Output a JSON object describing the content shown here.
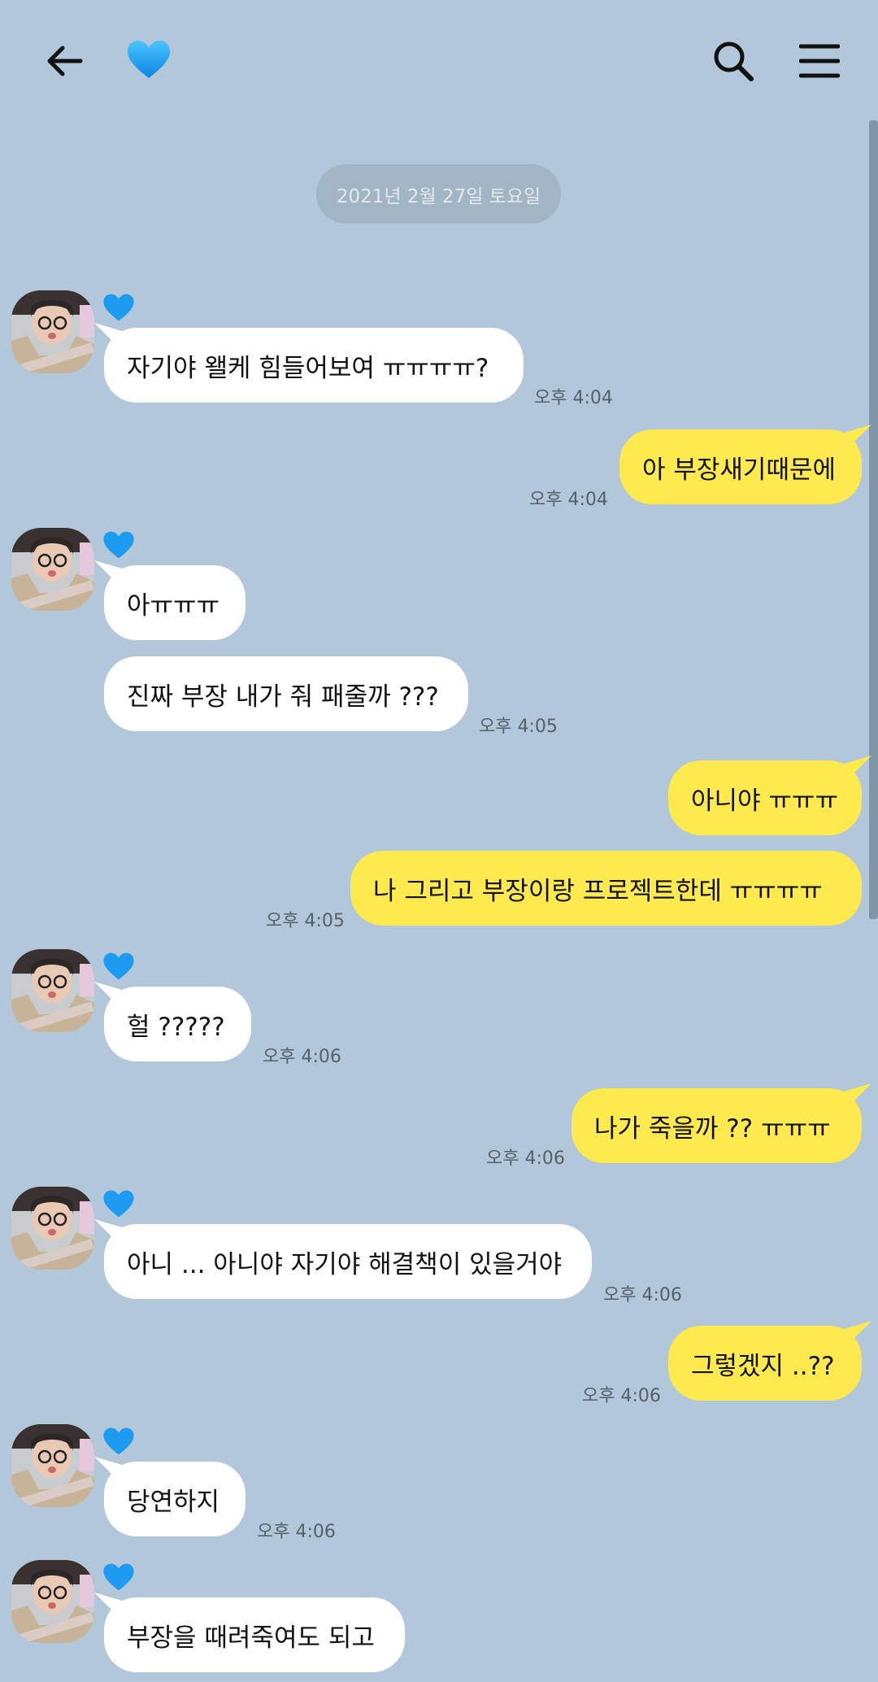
{
  "header": {
    "back_icon": "arrow-left-icon",
    "title_icon": "blue-heart-icon",
    "search_icon": "search-icon",
    "menu_icon": "hamburger-menu-icon"
  },
  "colors": {
    "background": "#b2c7d9",
    "incoming_bubble": "#ffffff",
    "outgoing_bubble": "#fee94e",
    "heart": "#1da1f2"
  },
  "date_divider": "2021년 2월 27일 토요일",
  "messages": [
    {
      "side": "in",
      "text": "자기야 왤케 힘들어보여 ㅠㅠㅠㅠ?",
      "time": "오후 4:04"
    },
    {
      "side": "out",
      "text": "아 부장새기때문에",
      "time": "오후 4:04"
    },
    {
      "side": "in",
      "text": "아ㅠㅠㅠ",
      "time": ""
    },
    {
      "side": "in",
      "text": "진짜 부장 내가 줘 패줄까 ???",
      "time": "오후 4:05"
    },
    {
      "side": "out",
      "text": "아니야 ㅠㅠㅠ",
      "time": ""
    },
    {
      "side": "out",
      "text": "나 그리고 부장이랑 프로젝트한데 ㅠㅠㅠㅠ",
      "time": "오후 4:05"
    },
    {
      "side": "in",
      "text": "헐 ?????",
      "time": "오후 4:06"
    },
    {
      "side": "out",
      "text": "나가 죽을까 ?? ㅠㅠㅠ",
      "time": "오후 4:06"
    },
    {
      "side": "in",
      "text": "아니 ... 아니야 자기야 해결책이 있을거야",
      "time": "오후 4:06"
    },
    {
      "side": "out",
      "text": "그렇겠지 ..??",
      "time": "오후 4:06"
    },
    {
      "side": "in",
      "text": "당연하지",
      "time": "오후 4:06"
    },
    {
      "side": "in",
      "text": "부장을 때려죽여도 되고",
      "time": ""
    }
  ]
}
